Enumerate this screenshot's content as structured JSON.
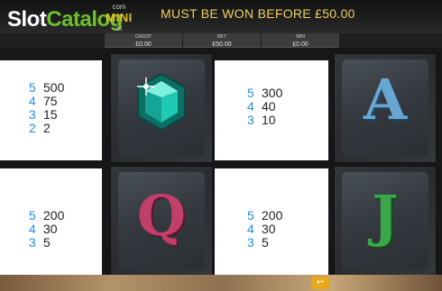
{
  "header": {
    "logo_part1": "Slot",
    "logo_part2": "Catalog",
    "badge_com": "com",
    "badge_word": "MINI",
    "badge_sub": "ot",
    "message": "MUST BE WON BEFORE  £50.00"
  },
  "stats": [
    {
      "label": "CREDIT",
      "value": "£0.00"
    },
    {
      "label": "BET",
      "value": "£50.00"
    },
    {
      "label": "WIN",
      "value": "£0.00"
    }
  ],
  "paytable": {
    "gem": {
      "symbol_icon": "gem-icon",
      "pays": [
        {
          "count": "5",
          "amount": "500"
        },
        {
          "count": "4",
          "amount": "75"
        },
        {
          "count": "3",
          "amount": "15"
        },
        {
          "count": "2",
          "amount": "2"
        }
      ]
    },
    "ace": {
      "symbol": "A",
      "pays": [
        {
          "count": "5",
          "amount": "300"
        },
        {
          "count": "4",
          "amount": "40"
        },
        {
          "count": "3",
          "amount": "10"
        }
      ]
    },
    "queen": {
      "symbol": "Q",
      "pays": [
        {
          "count": "5",
          "amount": "200"
        },
        {
          "count": "4",
          "amount": "30"
        },
        {
          "count": "3",
          "amount": "5"
        }
      ]
    },
    "jack": {
      "symbol": "J",
      "pays": [
        {
          "count": "5",
          "amount": "200"
        },
        {
          "count": "4",
          "amount": "30"
        },
        {
          "count": "3",
          "amount": "5"
        }
      ]
    }
  },
  "colors": {
    "count_blue": "#1f8fd6",
    "logo_green": "#6dbf2e",
    "gold_text": "#f0d060",
    "gem_teal": "#1fc9b4",
    "ace_blue": "#6aa7d0",
    "queen_pink": "#c0406a",
    "jack_green": "#3aa84a"
  },
  "bottom": {
    "button_icon": "arrow-icon",
    "button_glyph": "↩"
  }
}
